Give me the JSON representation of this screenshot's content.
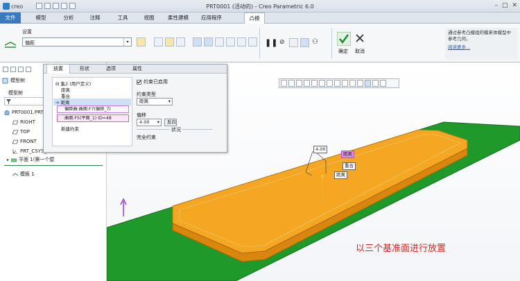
{
  "app": {
    "logo": "creo",
    "window_title": "PRT0001 (活动的) - Creo Parametric 6.0"
  },
  "tabs": [
    {
      "label": "文件"
    },
    {
      "label": "模型"
    },
    {
      "label": "分析"
    },
    {
      "label": "注释"
    },
    {
      "label": "工具"
    },
    {
      "label": "视图"
    },
    {
      "label": "柔性建模"
    },
    {
      "label": "应用程序"
    },
    {
      "label": "凸模"
    }
  ],
  "ribbon": {
    "group_label": "设置",
    "setting_value": "偏距",
    "ok_label": "确定",
    "cancel_label": "取消"
  },
  "info_panel": {
    "text": "通过参考凸模组的模来体模型中参考几何。",
    "link": "阅读更多..."
  },
  "left_panel": {
    "tab_model_tree": "模型树",
    "tab_label": "模型树",
    "tree": [
      {
        "label": "PRT0001.PRT"
      },
      {
        "label": "RIGHT"
      },
      {
        "label": "TOP"
      },
      {
        "label": "FRONT"
      },
      {
        "label": "PRT_CSYS_DEF"
      },
      {
        "label": "平面 1(第一个壁"
      },
      {
        "label": "模板 1"
      }
    ]
  },
  "placement": {
    "tabs": [
      "放置",
      "形状",
      "选项",
      "属性"
    ],
    "active_tab": "放置",
    "set_title": "集2 (用户定义)",
    "constraints": [
      "距离",
      "重合",
      "距离"
    ],
    "ref1": "偏距曲:曲面:F7(偏移_7)",
    "ref2": "曲面:F5(平面_1) ID=48",
    "new_constraint": "新建约束",
    "constraint_enabled_label": "约束已启用",
    "constraint_type_label": "约束类型",
    "constraint_type_value": "距离",
    "offset_label": "偏移",
    "offset_value": "4.00",
    "flip_label": "反向",
    "status_label": "状况",
    "status_value": "完全约束"
  },
  "viewport": {
    "dimension_value": "4.00",
    "tag_distance_1": "距离",
    "tag_coincident": "重合",
    "tag_distance_2": "距离",
    "caption": "以三个基准面进行放置"
  },
  "colors": {
    "file_tab": "#3a78c0",
    "plate_green": "#1f9a2a",
    "part_orange": "#f5a623",
    "caption_red": "#e2231a"
  }
}
